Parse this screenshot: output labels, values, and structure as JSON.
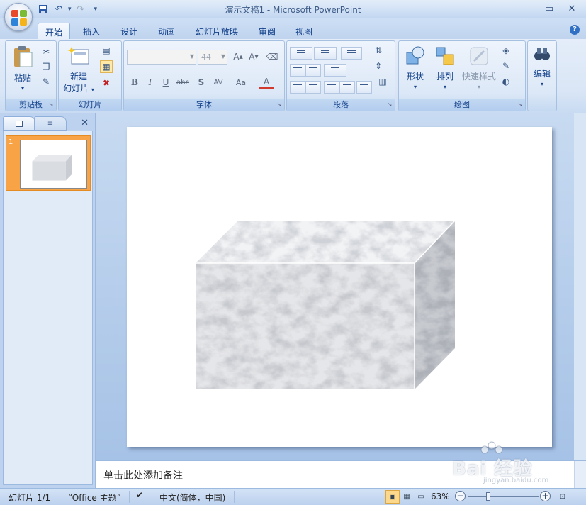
{
  "window": {
    "title": "演示文稿1 - Microsoft PowerPoint"
  },
  "quick_access": {
    "icons": [
      "save-icon",
      "undo-icon",
      "redo-icon",
      "customize-icon"
    ]
  },
  "ribbon": {
    "tabs": [
      {
        "label": "开始",
        "active": true
      },
      {
        "label": "插入"
      },
      {
        "label": "设计"
      },
      {
        "label": "动画"
      },
      {
        "label": "幻灯片放映"
      },
      {
        "label": "审阅"
      },
      {
        "label": "视图"
      }
    ],
    "groups": {
      "clipboard": {
        "label": "剪贴板",
        "paste": "粘贴"
      },
      "slides": {
        "label": "幻灯片",
        "new_slide_line1": "新建",
        "new_slide_line2": "幻灯片"
      },
      "font": {
        "label": "字体",
        "font_name": "",
        "font_size": "44"
      },
      "paragraph": {
        "label": "段落"
      },
      "drawing": {
        "label": "绘图",
        "shape": "形状",
        "arrange": "排列",
        "quick_styles": "快速样式"
      },
      "editing": {
        "label": "编辑"
      }
    }
  },
  "slides_pane": {
    "slides": [
      {
        "number": "1",
        "selected": true
      }
    ]
  },
  "notes": {
    "placeholder": "单击此处添加备注"
  },
  "status_bar": {
    "slide_info": "幻灯片 1/1",
    "theme": "“Office 主题”",
    "language": "中文(简体，中国)",
    "zoom": "63%",
    "zoom_fraction": 0.63
  },
  "watermark": {
    "text": "Bai 经验",
    "sub": "jingyan.baidu.com"
  },
  "colors": {
    "ribbon_text": "#15428b",
    "selected_thumb": "#f7a346"
  }
}
